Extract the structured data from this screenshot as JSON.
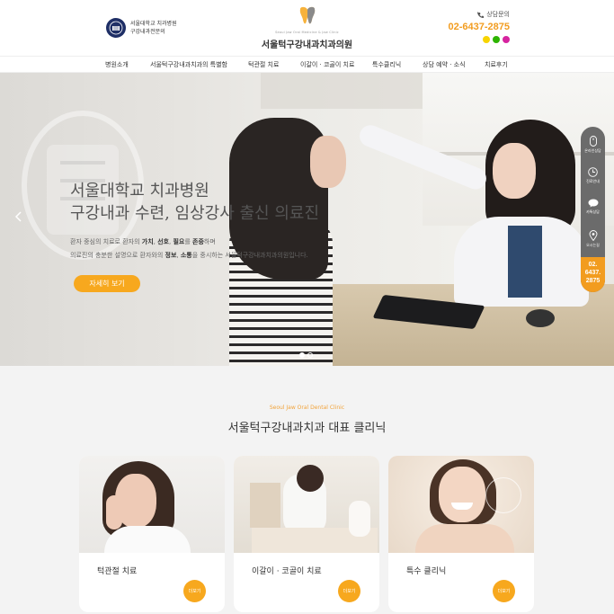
{
  "header": {
    "snu_line1": "서울대학교 치과병원",
    "snu_line2": "구강내과전문의",
    "logo_sub": "Seoul Jaw Oral Medicine & Jaw Clinic",
    "logo_name": "서울턱구강내과치과의원",
    "contact_label": "상담문의",
    "contact_phone": "02-6437-2875",
    "colors": {
      "accent": "#f29c1f",
      "kakao": "#f7d400",
      "naver": "#2db400",
      "insta": "#d6249f"
    }
  },
  "nav": {
    "items": [
      "병원소개",
      "서울턱구강내과치과의 특별함",
      "턱관절 치료",
      "이갈이 · 코골이 치료",
      "특수클리닉",
      "상담 예약 · 소식",
      "치료후기"
    ]
  },
  "hero": {
    "title_line1": "서울대학교 치과병원",
    "title_line2": "구강내과 수련, 임상강사 출신 의료진",
    "desc": {
      "l1_a": "환자 중심의 치료로 환자의 ",
      "l1_b1": "가치",
      "l1_s1": ", ",
      "l1_b2": "선호",
      "l1_s2": ", ",
      "l1_b3": "필요",
      "l1_s3": "를 ",
      "l1_b4": "존중",
      "l1_c": "하며",
      "l2_a": "의료진의 충분한 설명으로 환자와의 ",
      "l2_b1": "정보",
      "l2_s1": ", ",
      "l2_b2": "소통",
      "l2_c": "을 중시하는 서울턱구강내과치과의원입니다."
    },
    "button": "자세히 보기"
  },
  "quick": {
    "items": [
      "온라인상담",
      "진료안내",
      "카톡상담",
      "오시는길"
    ],
    "phone_l1": "02.",
    "phone_l2": "6437.",
    "phone_l3": "2875"
  },
  "clinic": {
    "en": "Seoul Jaw Oral Dental Clinic",
    "title": "서울턱구강내과치과 대표 클리닉",
    "cards": [
      {
        "title": "턱관절 치료",
        "more": "더보기"
      },
      {
        "title": "이갈이 · 코골이 치료",
        "more": "더보기"
      },
      {
        "title": "특수 클리닉",
        "more": "더보기"
      }
    ]
  }
}
